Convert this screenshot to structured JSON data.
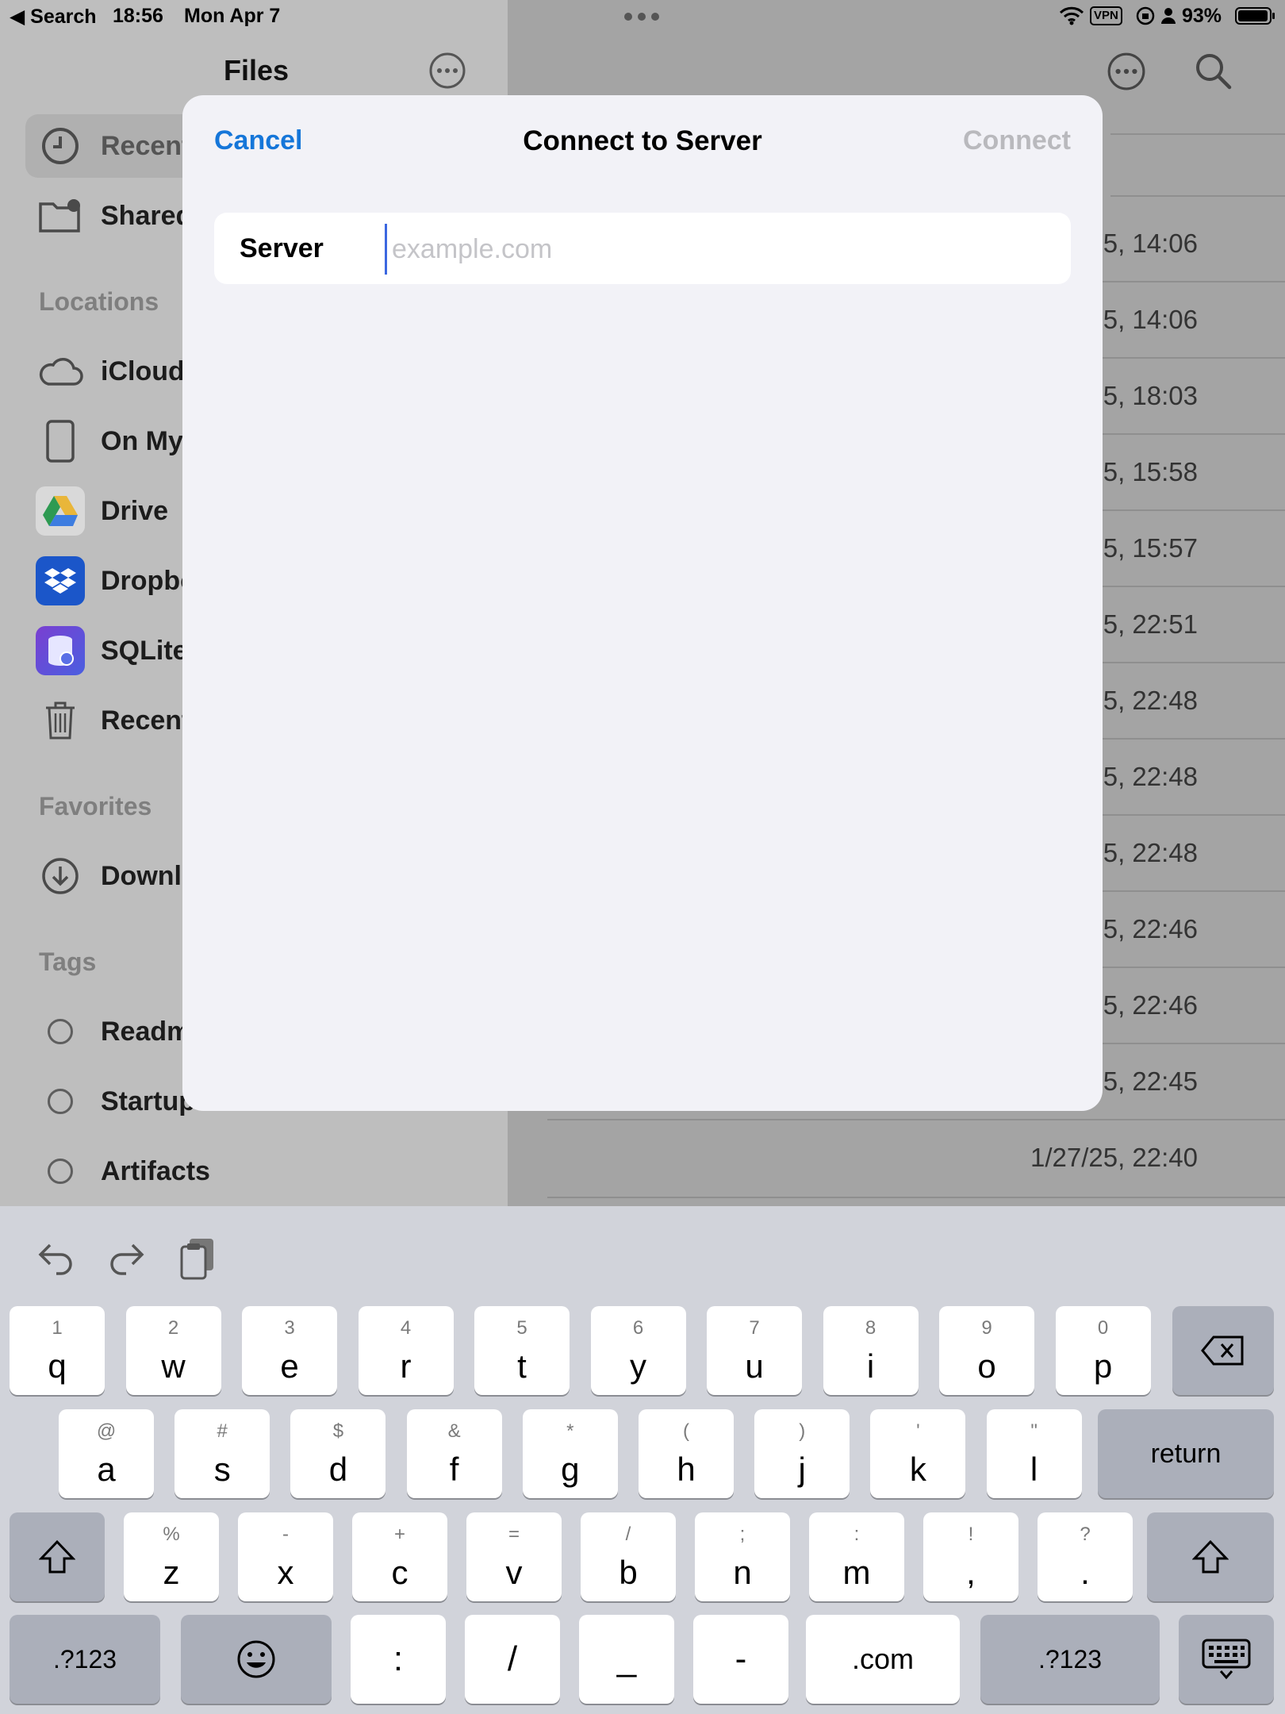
{
  "status_bar": {
    "back_app": "Search",
    "time": "18:56",
    "date": "Mon Apr 7",
    "vpn": "VPN",
    "battery": "93%"
  },
  "sidebar": {
    "title": "Files",
    "items_top": [
      {
        "label": "Recent",
        "icon": "clock-icon"
      },
      {
        "label": "Shared",
        "icon": "shared-folder-icon"
      }
    ],
    "locations_title": "Locations",
    "locations": [
      {
        "label": "iCloud",
        "icon": "cloud-icon"
      },
      {
        "label": "On My",
        "icon": "ipad-icon"
      },
      {
        "label": "Drive",
        "icon": "google-drive-icon"
      },
      {
        "label": "Dropbo",
        "icon": "dropbox-icon"
      },
      {
        "label": "SQLite",
        "icon": "sqlite-icon"
      },
      {
        "label": "Recent",
        "icon": "trash-icon"
      }
    ],
    "favorites_title": "Favorites",
    "favorites": [
      {
        "label": "Downlo",
        "icon": "download-icon"
      }
    ],
    "tags_title": "Tags",
    "tags": [
      {
        "label": "Readm"
      },
      {
        "label": "Startup"
      },
      {
        "label": "Artifacts"
      }
    ]
  },
  "content": {
    "rows": [
      "5, 14:06",
      "5, 14:06",
      "5, 18:03",
      "5, 15:58",
      "5, 15:57",
      "5, 22:51",
      "5, 22:48",
      "5, 22:48",
      "5, 22:48",
      "5, 22:46",
      "5, 22:46",
      "5, 22:45",
      "1/27/25, 22:40"
    ]
  },
  "modal": {
    "cancel_label": "Cancel",
    "title": "Connect to Server",
    "connect_label": "Connect",
    "field_label": "Server",
    "field_value": "",
    "field_placeholder": "example.com",
    "colors": {
      "accent": "#1576d9",
      "disabled": "#b9b9bd"
    }
  },
  "keyboard": {
    "row1": [
      {
        "main": "q",
        "sub": "1"
      },
      {
        "main": "w",
        "sub": "2"
      },
      {
        "main": "e",
        "sub": "3"
      },
      {
        "main": "r",
        "sub": "4"
      },
      {
        "main": "t",
        "sub": "5"
      },
      {
        "main": "y",
        "sub": "6"
      },
      {
        "main": "u",
        "sub": "7"
      },
      {
        "main": "i",
        "sub": "8"
      },
      {
        "main": "o",
        "sub": "9"
      },
      {
        "main": "p",
        "sub": "0"
      }
    ],
    "row2": [
      {
        "main": "a",
        "sub": "@"
      },
      {
        "main": "s",
        "sub": "#"
      },
      {
        "main": "d",
        "sub": "$"
      },
      {
        "main": "f",
        "sub": "&"
      },
      {
        "main": "g",
        "sub": "*"
      },
      {
        "main": "h",
        "sub": "("
      },
      {
        "main": "j",
        "sub": ")"
      },
      {
        "main": "k",
        "sub": "'"
      },
      {
        "main": "l",
        "sub": "\""
      }
    ],
    "return_label": "return",
    "row3": [
      {
        "main": "z",
        "sub": "%"
      },
      {
        "main": "x",
        "sub": "-"
      },
      {
        "main": "c",
        "sub": "+"
      },
      {
        "main": "v",
        "sub": "="
      },
      {
        "main": "b",
        "sub": "/"
      },
      {
        "main": "n",
        "sub": ";"
      },
      {
        "main": "m",
        "sub": ":"
      },
      {
        "main": ",",
        "sub": "!"
      },
      {
        "main": ".",
        "sub": "?"
      }
    ],
    "row4": {
      "numbers_left": ".?123",
      "colon": ":",
      "slash": "/",
      "underscore": "_",
      "dash": "-",
      "dotcom": ".com",
      "numbers_right": ".?123"
    }
  }
}
